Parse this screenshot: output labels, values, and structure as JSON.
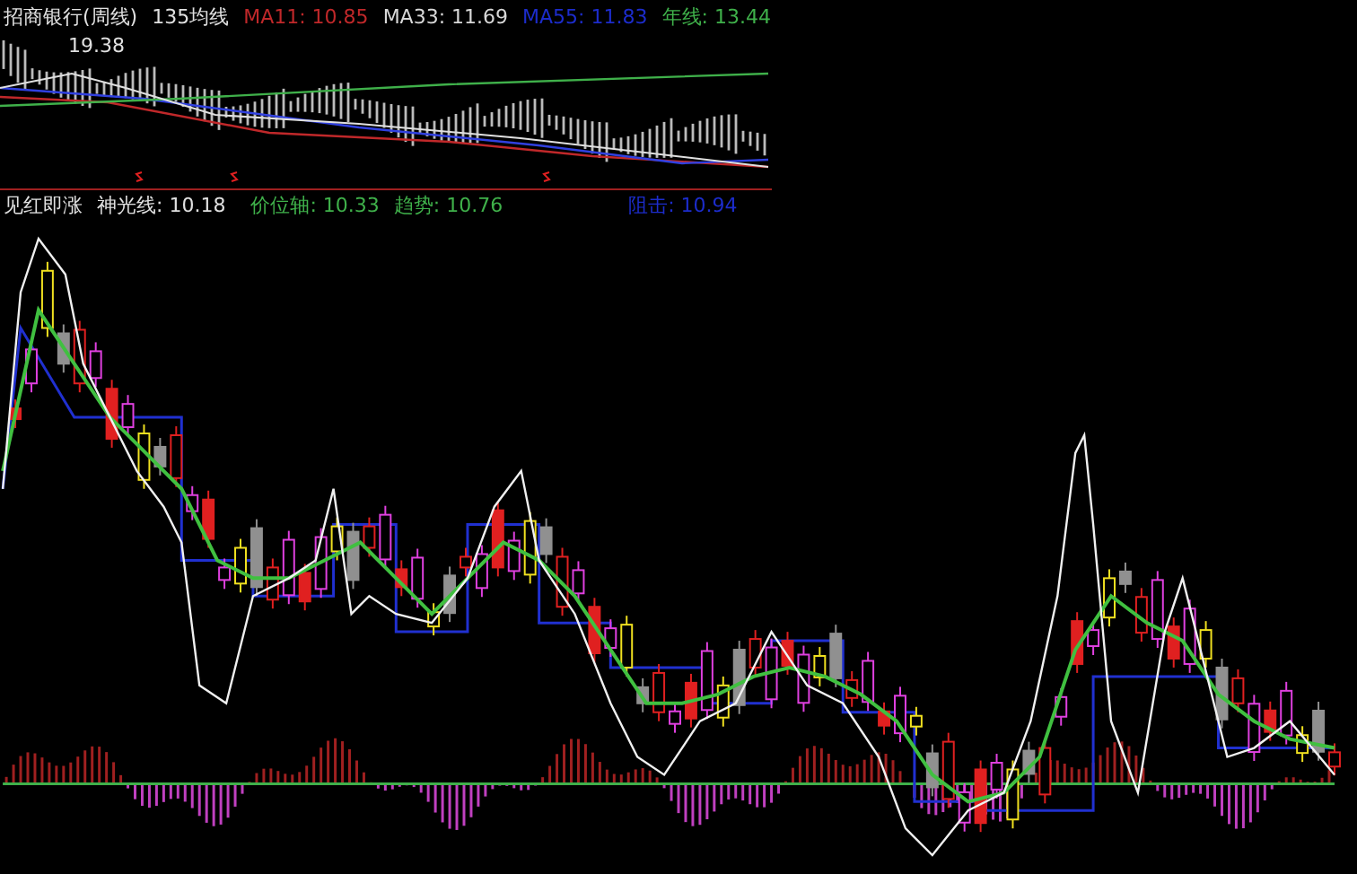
{
  "weekly_panel": {
    "title": "招商银行(周线)",
    "period_label": "135均线",
    "legend": [
      {
        "text": "MA11: 10.85",
        "color": "#c0282a"
      },
      {
        "text": "MA33: 11.69",
        "color": "#d8d8d8"
      },
      {
        "text": "MA55: 11.83",
        "color": "#1c2ccc"
      },
      {
        "text": "年线: 13.44",
        "color": "#3fb04a"
      }
    ],
    "high_label": "19.38"
  },
  "indicator_panel": {
    "legend": [
      {
        "text": "见红即涨",
        "color": "#e0e0e0"
      },
      {
        "text": "神光线: 10.18",
        "color": "#e0e0e0"
      },
      {
        "text": "价位轴: 10.33",
        "color": "#3fb04a"
      },
      {
        "text": "趋势: 10.76",
        "color": "#3fb04a"
      },
      {
        "text": "阻击: 10.94",
        "color": "#1c2ccc"
      }
    ]
  }
}
